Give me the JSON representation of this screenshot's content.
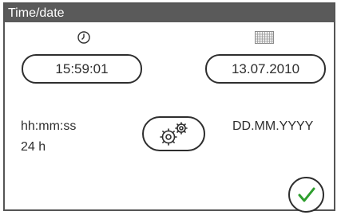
{
  "window": {
    "title": "Time/date"
  },
  "time": {
    "icon": "clock-icon",
    "value": "15:59:01",
    "format": "hh:mm:ss",
    "mode": "24 h"
  },
  "date": {
    "icon": "calendar-icon",
    "value": "13.07.2010",
    "format": "DD.MM.YYYY"
  },
  "buttons": {
    "settings_icon": "gears-icon",
    "confirm_icon": "checkmark-icon"
  },
  "colors": {
    "titlebar_bg": "#5a5a5a",
    "titlebar_text": "#ffffff",
    "outline": "#2e2e2e",
    "confirm_check": "#2e9e2e"
  }
}
